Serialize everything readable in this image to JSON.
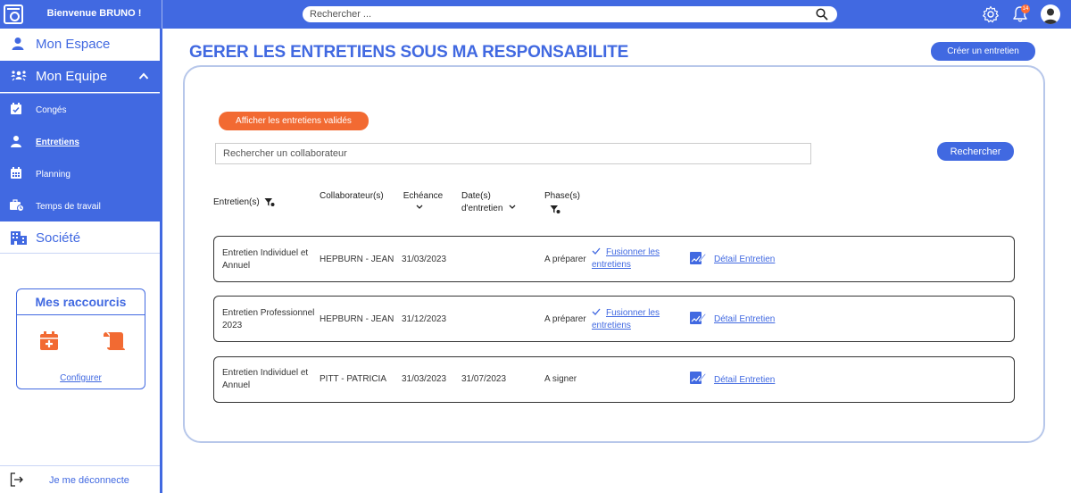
{
  "header": {
    "welcome": "Bienvenue BRUNO !",
    "search_placeholder": "Rechercher ...",
    "notif_count": "14"
  },
  "sidebar": {
    "mon_espace": "Mon Espace",
    "mon_equipe": "Mon Equipe",
    "sub_items": [
      {
        "label": "Congés"
      },
      {
        "label": "Entretiens"
      },
      {
        "label": "Planning"
      },
      {
        "label": "Temps de travail"
      }
    ],
    "societe": "Société",
    "shortcuts_title": "Mes raccourcis",
    "configure": "Configurer",
    "logout": "Je me déconnecte"
  },
  "main": {
    "title": "GERER LES ENTRETIENS SOUS MA RESPONSABILITE",
    "create_button": "Créer un entretien",
    "show_validated_button": "Afficher les entretiens validés",
    "collab_search_placeholder": "Rechercher un collaborateur",
    "search_button": "Rechercher",
    "columns": {
      "entretiens": "Entretien(s)",
      "collaborateurs": "Collaborateur(s)",
      "echeance": "Echéance",
      "date_line1": "Date(s)",
      "date_line2": "d'entretien",
      "phase": "Phase(s)"
    },
    "rows": [
      {
        "type_line1": "Entretien Individuel et",
        "type_line2": "Annuel",
        "collab": "HEPBURN - JEAN",
        "echeance": "31/03/2023",
        "date": "",
        "phase": "A préparer",
        "merge_line1": "Fusionner les",
        "merge_line2": "entretiens",
        "detail": "Détail Entretien"
      },
      {
        "type_line1": "Entretien Professionnel",
        "type_line2": "2023",
        "collab": "HEPBURN - JEAN",
        "echeance": "31/12/2023",
        "date": "",
        "phase": "A préparer",
        "merge_line1": "Fusionner les",
        "merge_line2": "entretiens",
        "detail": "Détail Entretien"
      },
      {
        "type_line1": "Entretien Individuel et",
        "type_line2": "Annuel",
        "collab": "PITT - PATRICIA",
        "echeance": "31/03/2023",
        "date": "31/07/2023",
        "phase": "A signer",
        "merge_line1": "",
        "merge_line2": "",
        "detail": "Détail Entretien"
      }
    ]
  },
  "colors": {
    "primary": "#4169e1",
    "accent": "#f26a32"
  },
  "icons": [
    "search-icon",
    "gear-icon",
    "bell-icon",
    "user-icon",
    "team-icon",
    "calendar-check-icon",
    "person-icon",
    "calendar-grid-icon",
    "briefcase-clock-icon",
    "building-icon",
    "calendar-add-icon",
    "scroll-icon",
    "logout-icon",
    "filter-icon",
    "chevron-down-icon",
    "chevron-up-icon",
    "check-icon",
    "edit-document-icon"
  ]
}
